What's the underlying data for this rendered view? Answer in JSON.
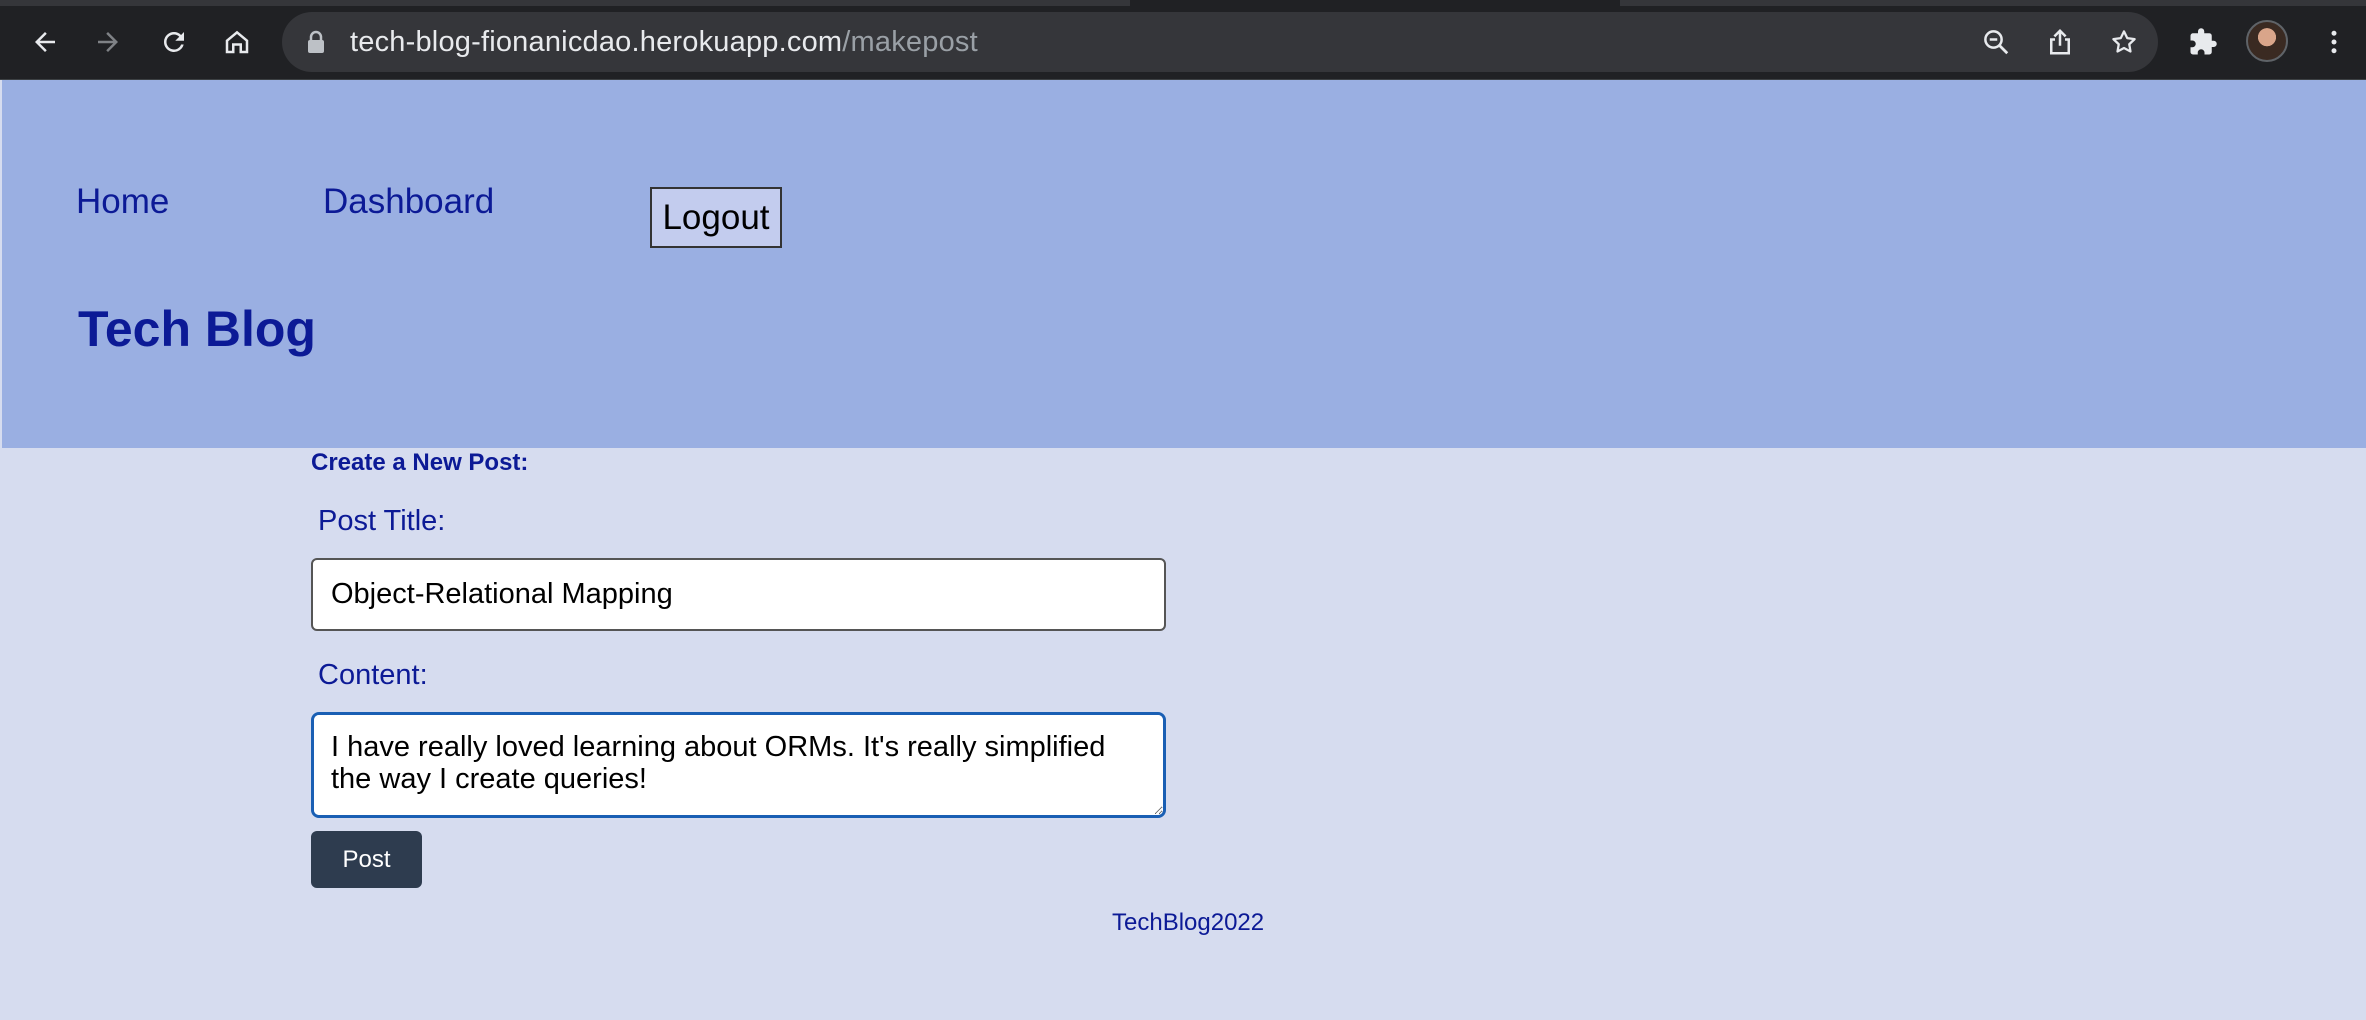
{
  "browser": {
    "url_host": "tech-blog-fionanicdao.herokuapp.com",
    "url_path": "/makepost",
    "icons": {
      "back": "back-arrow-icon",
      "forward": "forward-arrow-icon",
      "reload": "reload-icon",
      "home": "home-icon",
      "lock": "lock-icon",
      "zoom": "zoom-out-icon",
      "share": "share-icon",
      "bookmark": "star-icon",
      "extensions": "puzzle-icon",
      "menu": "kebab-menu-icon"
    }
  },
  "header": {
    "nav": {
      "home_label": "Home",
      "dashboard_label": "Dashboard",
      "logout_label": "Logout"
    },
    "site_title": "Tech Blog"
  },
  "form": {
    "heading": "Create a New Post:",
    "title_label": "Post Title:",
    "title_value": "Object-Relational Mapping",
    "content_label": "Content:",
    "content_value": "I have really loved learning about ORMs. It's really simplified the way I create queries!",
    "submit_label": "Post"
  },
  "footer": {
    "text": "TechBlog2022"
  },
  "colors": {
    "header_bg": "#9aafe2",
    "page_bg": "#d6dcef",
    "link": "#0c1a96",
    "post_button": "#2e3c4f",
    "focus_ring": "#1a5fb4"
  }
}
